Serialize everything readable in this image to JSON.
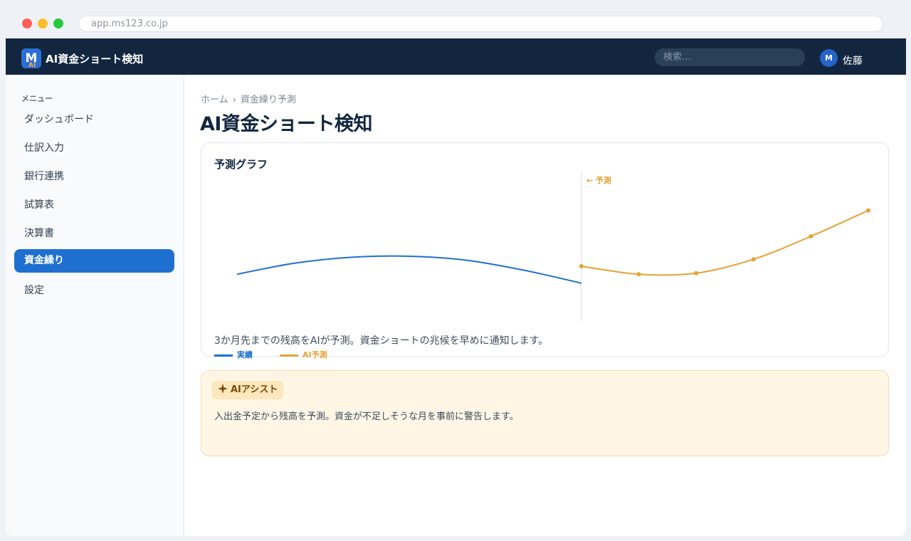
{
  "browser": {
    "url": "app.ms123.co.jp"
  },
  "topbar": {
    "logo_text": "M",
    "logo_badge": "AI",
    "app_title": "AI資金ショート検知",
    "search_placeholder": "検索…",
    "user_initial": "M",
    "user_name": "佐藤"
  },
  "sidebar": {
    "heading": "メニュー",
    "items": [
      {
        "label": "ダッシュボード",
        "active": false
      },
      {
        "label": "仕訳入力",
        "active": false
      },
      {
        "label": "銀行連携",
        "active": false
      },
      {
        "label": "試算表",
        "active": false
      },
      {
        "label": "決算書",
        "active": false
      },
      {
        "label": "資金繰り",
        "active": true
      },
      {
        "label": "設定",
        "active": false
      }
    ]
  },
  "main": {
    "breadcrumb": [
      "ホーム",
      "資金繰り予測"
    ],
    "breadcrumb_sep": "›",
    "page_title": "AI資金ショート検知"
  },
  "chart_card": {
    "title": "予測グラフ",
    "description": "3か月先までの残高をAIが予測。資金ショートの兆候を早めに通知します。"
  },
  "chart_data": {
    "type": "line",
    "forecast_marker_label": "← 予測",
    "series": [
      {
        "name": "実績",
        "color": "#1f6fd1",
        "x": [
          0,
          1,
          2,
          3,
          4,
          5,
          6
        ],
        "values": [
          47,
          58,
          64,
          65,
          61,
          51,
          38
        ],
        "markers": false
      },
      {
        "name": "AI予測",
        "color": "#e5a235",
        "x": [
          6,
          7,
          8,
          9,
          10,
          11
        ],
        "values": [
          55,
          47,
          48,
          62,
          85,
          111
        ],
        "markers": true
      }
    ],
    "forecast_start_x": 6,
    "xlim": [
      0,
      11
    ],
    "ylim": [
      0,
      150
    ],
    "grid": false,
    "legend": "bottom-left"
  },
  "ai_card": {
    "badge_label": "AIアシスト",
    "badge_icon": "sparkle-icon",
    "text": "入出金予定から残高を予測。資金が不足しそうな月を事前に警告します。"
  },
  "colors": {
    "topbar": "#12263f",
    "accent": "#1f6fd1",
    "forecast": "#e5a235"
  }
}
